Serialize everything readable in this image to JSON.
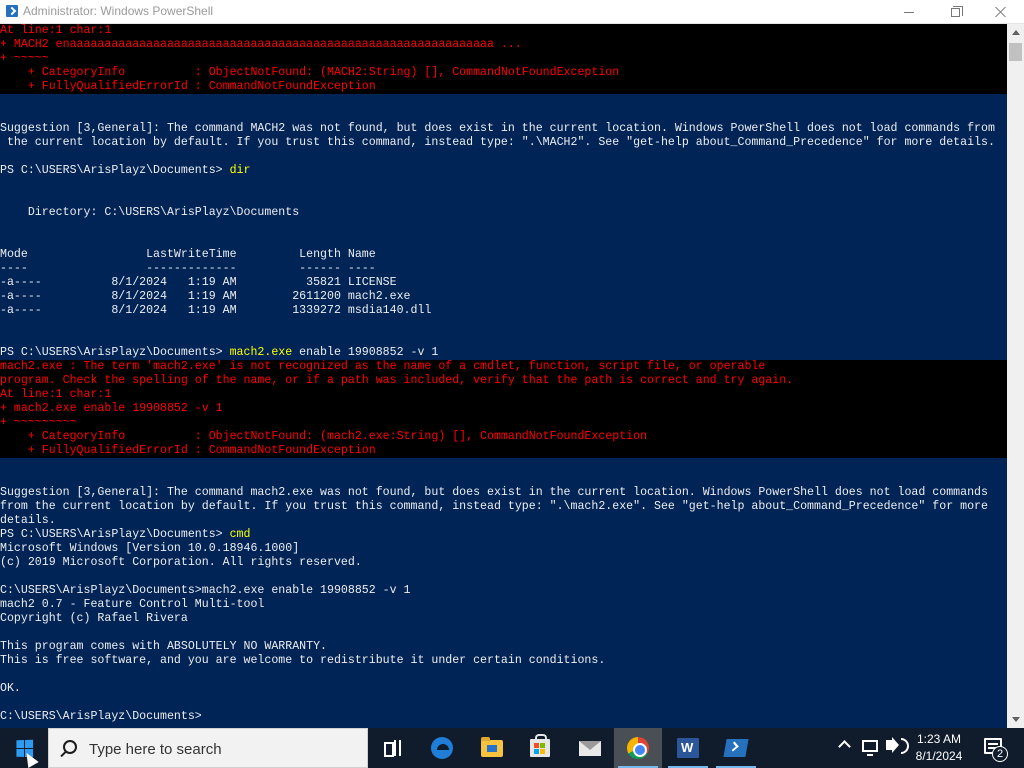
{
  "window": {
    "title": "Administrator: Windows PowerShell"
  },
  "console": {
    "lines": [
      {
        "text": "At line:1 char:1",
        "err": true
      },
      {
        "text": "+ MACH2 enaaaaaaaaaaaaaaaaaaaaaaaaaaaaaaaaaaaaaaaaaaaaaaaaaaaaaaaaaaaaa ...",
        "err": true
      },
      {
        "text": "+ ~~~~~",
        "err": true
      },
      {
        "text": "    + CategoryInfo          : ObjectNotFound: (MACH2:String) [], CommandNotFoundException",
        "err": true
      },
      {
        "text": "    + FullyQualifiedErrorId : CommandNotFoundException",
        "err": true
      },
      {
        "text": ""
      },
      {
        "text": ""
      },
      {
        "text": "Suggestion [3,General]: The command MACH2 was not found, but does exist in the current location. Windows PowerShell does not load commands from"
      },
      {
        "text": " the current location by default. If you trust this command, instead type: \".\\MACH2\". See \"get-help about_Command_Precedence\" for more details."
      },
      {
        "text": ""
      },
      {
        "text": "PS C:\\USERS\\ArisPlayz\\Documents> ",
        "cmd": "dir"
      },
      {
        "text": ""
      },
      {
        "text": ""
      },
      {
        "text": "    Directory: C:\\USERS\\ArisPlayz\\Documents"
      },
      {
        "text": ""
      },
      {
        "text": ""
      },
      {
        "text": "Mode                 LastWriteTime         Length Name"
      },
      {
        "text": "----                 -------------         ------ ----"
      },
      {
        "text": "-a----          8/1/2024   1:19 AM          35821 LICENSE"
      },
      {
        "text": "-a----          8/1/2024   1:19 AM        2611200 mach2.exe"
      },
      {
        "text": "-a----          8/1/2024   1:19 AM        1339272 msdia140.dll"
      },
      {
        "text": ""
      },
      {
        "text": ""
      },
      {
        "text": "PS C:\\USERS\\ArisPlayz\\Documents> ",
        "cmd": "mach2.exe",
        "param": " enable 19908852 -v 1"
      },
      {
        "text": "mach2.exe : The term 'mach2.exe' is not recognized as the name of a cmdlet, function, script file, or operable",
        "err": true
      },
      {
        "text": "program. Check the spelling of the name, or if a path was included, verify that the path is correct and try again.",
        "err": true
      },
      {
        "text": "At line:1 char:1",
        "err": true
      },
      {
        "text": "+ mach2.exe enable 19908852 -v 1",
        "err": true
      },
      {
        "text": "+ ~~~~~~~~~",
        "err": true
      },
      {
        "text": "    + CategoryInfo          : ObjectNotFound: (mach2.exe:String) [], CommandNotFoundException",
        "err": true
      },
      {
        "text": "    + FullyQualifiedErrorId : CommandNotFoundException",
        "err": true
      },
      {
        "text": ""
      },
      {
        "text": ""
      },
      {
        "text": "Suggestion [3,General]: The command mach2.exe was not found, but does exist in the current location. Windows PowerShell does not load commands"
      },
      {
        "text": "from the current location by default. If you trust this command, instead type: \".\\mach2.exe\". See \"get-help about_Command_Precedence\" for more"
      },
      {
        "text": "details."
      },
      {
        "text": "PS C:\\USERS\\ArisPlayz\\Documents> ",
        "cmd": "cmd"
      },
      {
        "text": "Microsoft Windows [Version 10.0.18946.1000]"
      },
      {
        "text": "(c) 2019 Microsoft Corporation. All rights reserved."
      },
      {
        "text": ""
      },
      {
        "text": "C:\\USERS\\ArisPlayz\\Documents>mach2.exe enable 19908852 -v 1"
      },
      {
        "text": "mach2 0.7 - Feature Control Multi-tool"
      },
      {
        "text": "Copyright (c) Rafael Rivera"
      },
      {
        "text": ""
      },
      {
        "text": "This program comes with ABSOLUTELY NO WARRANTY."
      },
      {
        "text": "This is free software, and you are welcome to redistribute it under certain conditions."
      },
      {
        "text": ""
      },
      {
        "text": "OK."
      },
      {
        "text": ""
      },
      {
        "text": "C:\\USERS\\ArisPlayz\\Documents>"
      }
    ]
  },
  "taskbar": {
    "search_placeholder": "Type here to search",
    "apps": [
      {
        "name": "task-view",
        "icon": "task-view-icon",
        "active": false,
        "running": false
      },
      {
        "name": "edge",
        "icon": "edge-icon",
        "active": false,
        "running": false
      },
      {
        "name": "file-explorer",
        "icon": "folder-icon",
        "active": false,
        "running": false
      },
      {
        "name": "store",
        "icon": "store-icon",
        "active": false,
        "running": false
      },
      {
        "name": "mail",
        "icon": "mail-icon",
        "active": false,
        "running": false
      },
      {
        "name": "chrome",
        "icon": "chrome-icon",
        "active": true,
        "running": true
      },
      {
        "name": "word",
        "icon": "word-icon",
        "active": false,
        "running": true
      },
      {
        "name": "powershell",
        "icon": "powershell-icon",
        "active": false,
        "running": true
      }
    ],
    "clock_time": "1:23 AM",
    "clock_date": "8/1/2024",
    "notification_count": "2"
  },
  "colors": {
    "console_bg": "#012456",
    "console_fg": "#eeedf0",
    "error_fg": "#ff0000",
    "error_bg": "#000000",
    "command_fg": "#ffff00",
    "taskbar_bg": "#101b2b"
  }
}
